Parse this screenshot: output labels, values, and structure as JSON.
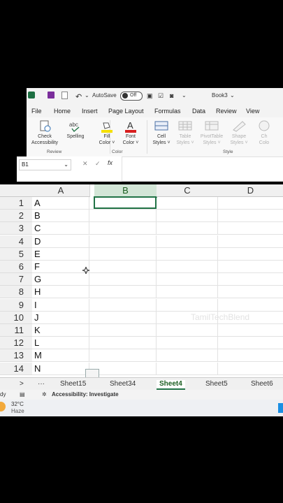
{
  "titlebar": {
    "autosave_label": "AutoSave",
    "autosave_state": "Off",
    "book_name": "Book3",
    "chevron": "⌄"
  },
  "menu": {
    "file": "File",
    "home": "Home",
    "insert": "Insert",
    "page_layout": "Page Layout",
    "formulas": "Formulas",
    "data": "Data",
    "review": "Review",
    "view": "View"
  },
  "ribbon": {
    "check_line1": "Check",
    "check_line2": "Accessibility",
    "spelling": "Spelling",
    "review_group": "Review",
    "fill_line1": "Fill",
    "fill_line2": "Color ˅",
    "font_line1": "Font",
    "font_line2": "Color ˅",
    "color_group": "Color",
    "cell_line1": "Cell",
    "cell_line2": "Styles ˅",
    "table_line1": "Table",
    "table_line2": "Styles ˅",
    "pivot_line1": "PivotTable",
    "pivot_line2": "Styles ˅",
    "shape_line1": "Shape",
    "shape_line2": "Styles ˅",
    "chart_line1": "Ch",
    "chart_line2": "Colo",
    "style_group": "Style",
    "fill_accent": "#f5e000",
    "font_accent": "#d81e1e"
  },
  "formula_bar": {
    "name_box": "B1",
    "fx": "fx",
    "value": ""
  },
  "grid": {
    "columns": [
      "A",
      "B",
      "C",
      "D"
    ],
    "selected_column": "B",
    "rows": [
      {
        "num": "1",
        "a": "A"
      },
      {
        "num": "2",
        "a": "B"
      },
      {
        "num": "3",
        "a": "C"
      },
      {
        "num": "4",
        "a": "D"
      },
      {
        "num": "5",
        "a": "E"
      },
      {
        "num": "6",
        "a": "F"
      },
      {
        "num": "7",
        "a": "G"
      },
      {
        "num": "8",
        "a": "H"
      },
      {
        "num": "9",
        "a": "I"
      },
      {
        "num": "10",
        "a": "J"
      },
      {
        "num": "11",
        "a": "K"
      },
      {
        "num": "12",
        "a": "L"
      },
      {
        "num": "13",
        "a": "M"
      },
      {
        "num": "14",
        "a": "N"
      }
    ]
  },
  "watermark": "TamilTechBlend",
  "sheets": {
    "arrow": ">",
    "more": "···",
    "tabs": [
      "Sheet15",
      "Sheet34",
      "Sheet4",
      "Sheet5",
      "Sheet6"
    ],
    "active": "Sheet4"
  },
  "status": {
    "ready": "dy",
    "accessibility": "Accessibility: Investigate"
  },
  "taskbar": {
    "temperature": "32°C",
    "condition": "Haze"
  },
  "colors": {
    "excel_green": "#217346",
    "accent_selected": "#d3e6d7"
  }
}
